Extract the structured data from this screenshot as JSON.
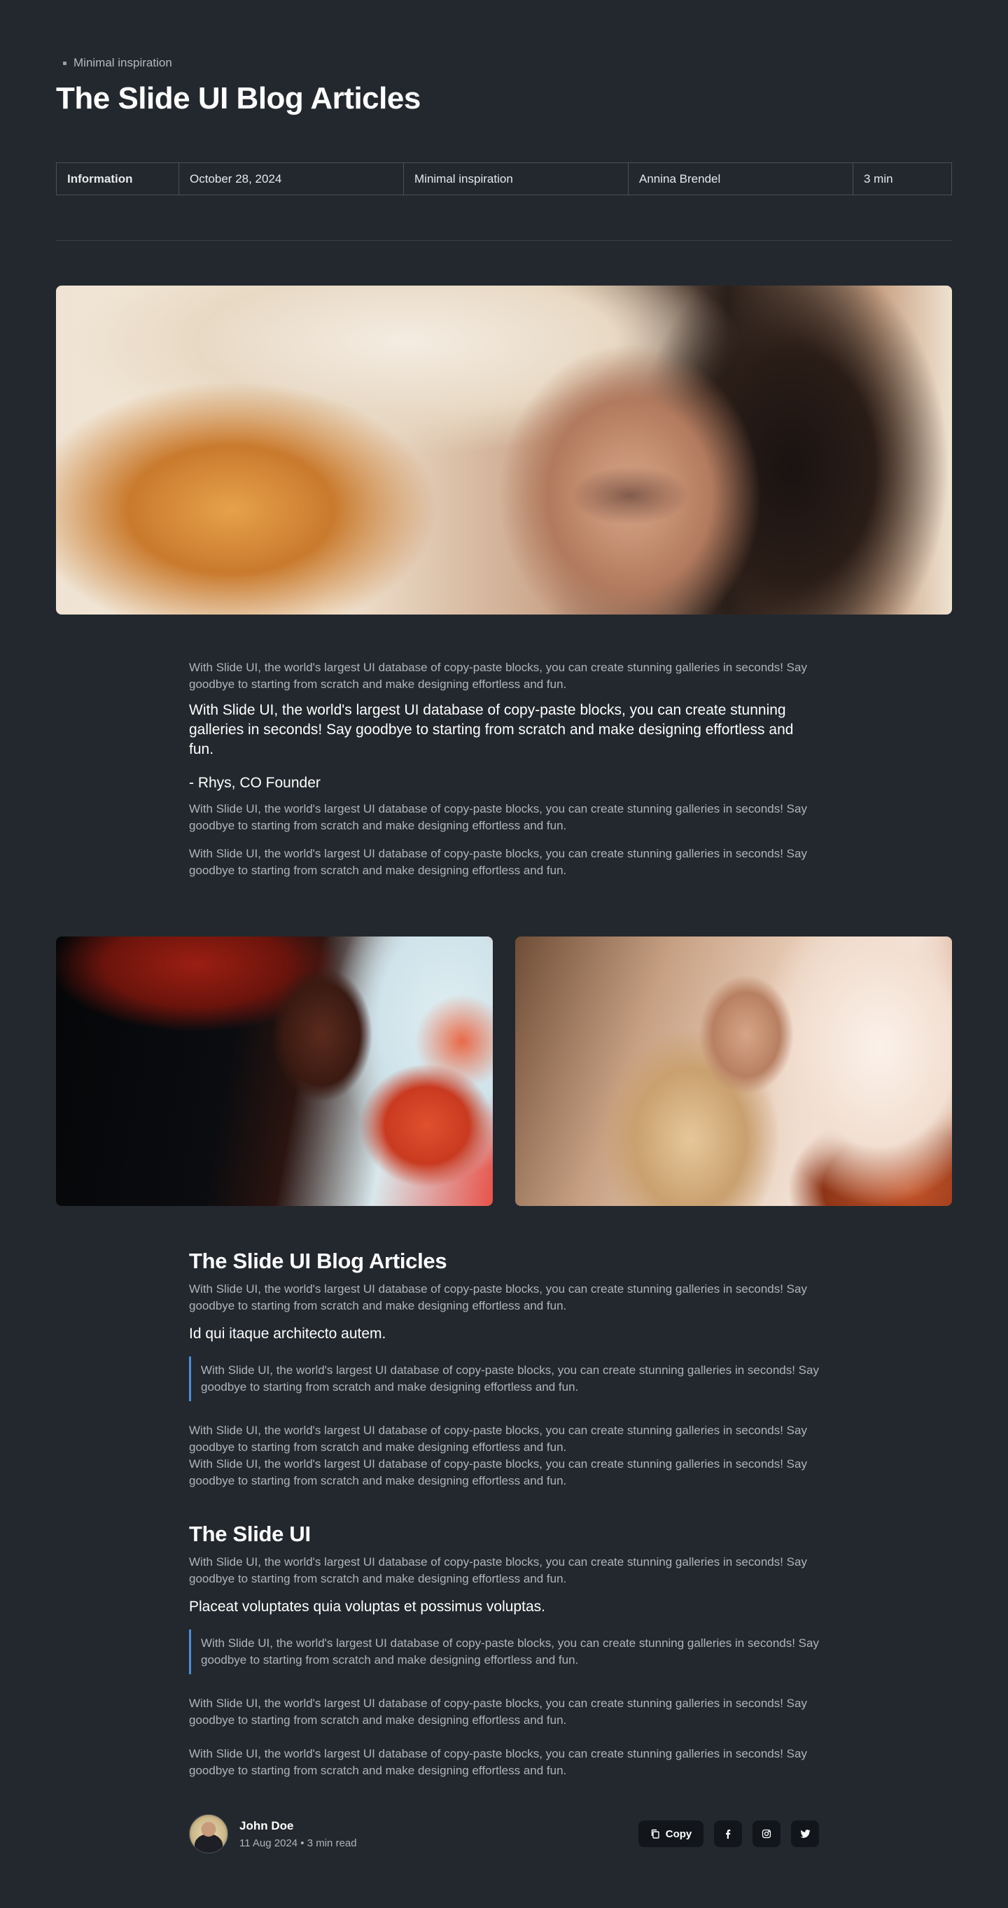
{
  "header": {
    "breadcrumb": "Minimal inspiration",
    "title": "The Slide UI Blog Articles"
  },
  "info": {
    "label": "Information",
    "date": "October 28, 2024",
    "category": "Minimal inspiration",
    "author": "Annina Brendel",
    "read_time": "3 min"
  },
  "article": {
    "intro": "With Slide UI, the world's largest UI database of copy-paste blocks, you can create stunning galleries in seconds! Say goodbye to starting from scratch and make designing effortless and fun.",
    "lead": "With Slide UI, the world's largest UI database of copy-paste blocks, you can create stunning galleries in seconds! Say goodbye to starting from scratch and make designing effortless and fun.",
    "quote_by": "- Rhys, CO Founder",
    "para_1": "With Slide UI, the world's largest UI database of copy-paste blocks, you can create stunning galleries in seconds! Say goodbye to starting from scratch and make designing effortless and fun.",
    "para_2": "With Slide UI, the world's largest UI database of copy-paste blocks, you can create stunning galleries in seconds! Say goodbye to starting from scratch and make designing effortless and fun.",
    "section_1": {
      "title": "The Slide UI Blog Articles",
      "para": "With Slide UI, the world's largest UI database of copy-paste blocks, you can create stunning galleries in seconds! Say goodbye to starting from scratch and make designing effortless and fun.",
      "subtitle": "Id qui itaque architecto autem.",
      "blockquote": "With Slide UI, the world's largest UI database of copy-paste blocks, you can create stunning galleries in seconds! Say goodbye to starting from scratch and make designing effortless and fun.",
      "para_a": "With Slide UI, the world's largest UI database of copy-paste blocks, you can create stunning galleries in seconds! Say goodbye to starting from scratch and make designing effortless and fun.",
      "para_b": "With Slide UI, the world's largest UI database of copy-paste blocks, you can create stunning galleries in seconds! Say goodbye to starting from scratch and make designing effortless and fun."
    },
    "section_2": {
      "title": "The Slide UI",
      "para": "With Slide UI, the world's largest UI database of copy-paste blocks, you can create stunning galleries in seconds! Say goodbye to starting from scratch and make designing effortless and fun.",
      "subtitle": "Placeat voluptates quia voluptas et possimus voluptas.",
      "blockquote": "With Slide UI, the world's largest UI database of copy-paste blocks, you can create stunning galleries in seconds! Say goodbye to starting from scratch and make designing effortless and fun.",
      "para_a": "With Slide UI, the world's largest UI database of copy-paste blocks, you can create stunning galleries in seconds! Say goodbye to starting from scratch and make designing effortless and fun.",
      "para_b": "With Slide UI, the world's largest UI database of copy-paste blocks, you can create stunning galleries in seconds! Say goodbye to starting from scratch and make designing effortless and fun."
    }
  },
  "footer": {
    "author_name": "John Doe",
    "author_meta": "11 Aug 2024 • 3 min read",
    "copy_label": "Copy",
    "icons": [
      "copy-icon",
      "facebook-icon",
      "instagram-icon",
      "twitter-icon"
    ]
  },
  "colors": {
    "background": "#23282e",
    "blockquote_accent": "#4a8fd9",
    "button_bg": "#12161b"
  }
}
